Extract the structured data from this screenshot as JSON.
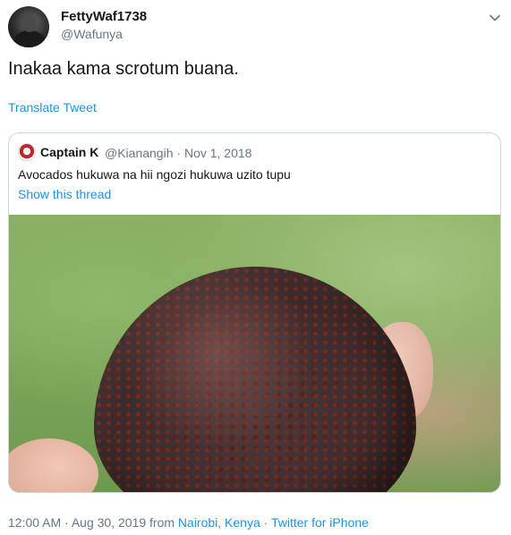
{
  "tweet": {
    "author": {
      "display_name": "FettyWaf1738",
      "handle": "@Wafunya"
    },
    "text": "Inakaa kama scrotum buana.",
    "translate_label": "Translate Tweet",
    "more_icon": "chevron-down-icon"
  },
  "quoted_tweet": {
    "author": {
      "display_name": "Captain K",
      "handle": "@Kianangih",
      "date": "Nov 1, 2018",
      "separator": "·"
    },
    "text": "Avocados hukuwa na hii ngozi hukuwa uzito tupu",
    "show_thread_label": "Show this thread"
  },
  "footer": {
    "time": "12:00 AM",
    "date": "Aug 30, 2019",
    "from_label": "from",
    "location": "Nairobi, Kenya",
    "source": "Twitter for iPhone",
    "separator": "·"
  },
  "colors": {
    "link": "#1b95e0",
    "secondary_text": "#657786",
    "border": "#ccd6dd"
  }
}
